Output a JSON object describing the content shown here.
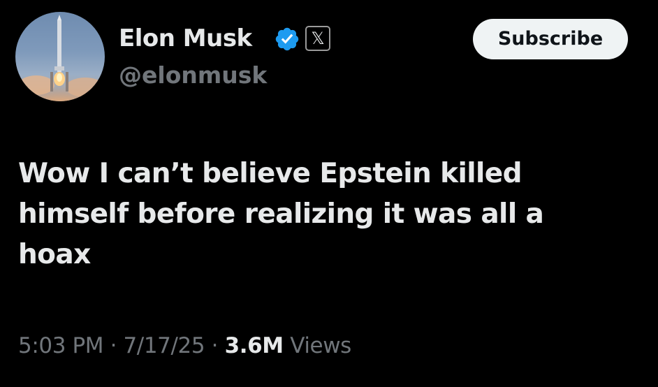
{
  "author": {
    "display_name": "Elon Musk",
    "handle": "@elonmusk",
    "avatar_icon": "rocket-launch-avatar",
    "verified_icon": "verified-badge-icon",
    "verified_color": "#1d9bf0",
    "affiliate_icon": "x-logo-icon",
    "affiliate_glyph": "𝕏"
  },
  "actions": {
    "subscribe_label": "Subscribe"
  },
  "tweet": {
    "lines": [
      "Wow I can’t believe Epstein killed",
      "himself before realizing it was all a",
      "hoax"
    ]
  },
  "meta": {
    "time": "5:03 PM",
    "separator": " · ",
    "date": "7/17/25",
    "views_count": "3.6M",
    "views_label": "Views"
  },
  "colors": {
    "background": "#000000",
    "primary_text": "#e7e9ea",
    "secondary_text": "#71767b",
    "button_bg": "#eff3f4"
  }
}
